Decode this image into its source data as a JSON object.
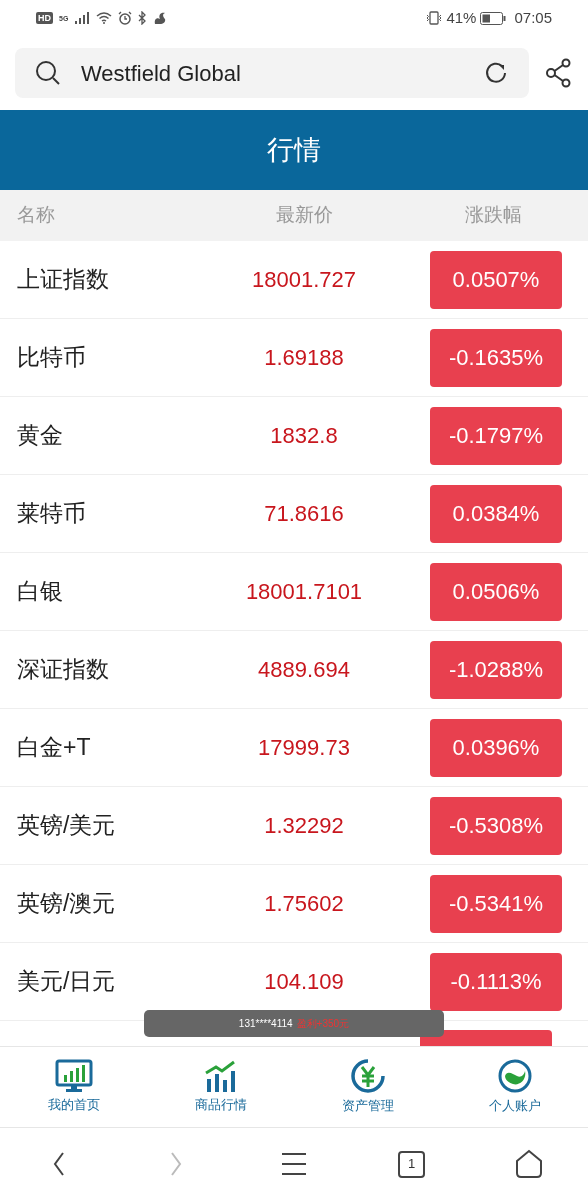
{
  "status_bar": {
    "hd": "HD",
    "network": "5G",
    "battery": "41%",
    "time": "07:05"
  },
  "search": {
    "value": "Westfield Global"
  },
  "header": {
    "title": "行情"
  },
  "table": {
    "columns": [
      "名称",
      "最新价",
      "涨跌幅"
    ],
    "rows": [
      {
        "name": "上证指数",
        "price": "18001.727",
        "change": "0.0507%"
      },
      {
        "name": "比特币",
        "price": "1.69188",
        "change": "-0.1635%"
      },
      {
        "name": "黄金",
        "price": "1832.8",
        "change": "-0.1797%"
      },
      {
        "name": "莱特币",
        "price": "71.8616",
        "change": "0.0384%"
      },
      {
        "name": "白银",
        "price": "18001.7101",
        "change": "0.0506%"
      },
      {
        "name": "深证指数",
        "price": "4889.694",
        "change": "-1.0288%"
      },
      {
        "name": "白金+T",
        "price": "17999.73",
        "change": "0.0396%"
      },
      {
        "name": "英镑/美元",
        "price": "1.32292",
        "change": "-0.5308%"
      },
      {
        "name": "英镑/澳元",
        "price": "1.75602",
        "change": "-0.5341%"
      },
      {
        "name": "美元/日元",
        "price": "104.109",
        "change": "-0.1113%"
      }
    ]
  },
  "toast": {
    "user": "131****4114",
    "profit": "盈利+350元"
  },
  "nav": [
    {
      "label": "我的首页",
      "kind": "home"
    },
    {
      "label": "商品行情",
      "kind": "market"
    },
    {
      "label": "资产管理",
      "kind": "assets"
    },
    {
      "label": "个人账户",
      "kind": "account"
    }
  ],
  "browser_bar": {
    "back_disabled": false,
    "forward_disabled": true,
    "tabs": "1"
  }
}
